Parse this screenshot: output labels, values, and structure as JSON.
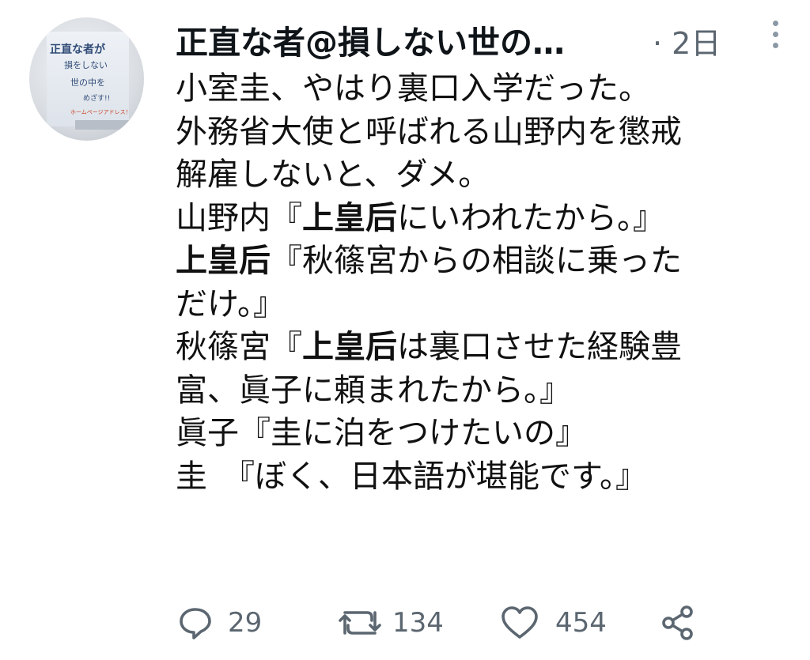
{
  "tweet": {
    "author_name": "正直な者@損しない世の…",
    "timestamp": "· 2日",
    "lines": [
      [
        {
          "t": "小室圭、やはり裏口入学だった。",
          "b": false
        }
      ],
      [
        {
          "t": "外務省大使と呼ばれる山野内を懲戒",
          "b": false
        }
      ],
      [
        {
          "t": "解雇しないと、ダメ。",
          "b": false
        }
      ],
      [
        {
          "t": "山野内『",
          "b": false
        },
        {
          "t": "上皇后",
          "b": true
        },
        {
          "t": "にいわれたから。』",
          "b": false
        }
      ],
      [
        {
          "t": "上皇后",
          "b": true
        },
        {
          "t": "『秋篠宮からの相談に乗った",
          "b": false
        }
      ],
      [
        {
          "t": "だけ。』",
          "b": false
        }
      ],
      [
        {
          "t": "秋篠宮『",
          "b": false
        },
        {
          "t": "上皇后",
          "b": true
        },
        {
          "t": "は裏口させた経験豊",
          "b": false
        }
      ],
      [
        {
          "t": "富、眞子に頼まれたから。』",
          "b": false
        }
      ],
      [
        {
          "t": "眞子『圭に泊をつけたいの』",
          "b": false
        }
      ],
      [
        {
          "t": "圭　『ぼく、日本語が堪能です。』",
          "b": false
        }
      ]
    ]
  },
  "avatar": {
    "line1": "正直な者が",
    "line2": "損をしない",
    "line3": "世の中を",
    "line4": "めざす!!",
    "line5": "ホームページアドレス！"
  },
  "actions": {
    "reply_count": "29",
    "retweet_count": "134",
    "like_count": "454"
  },
  "icons": {
    "reply": "reply-icon",
    "retweet": "retweet-icon",
    "like": "heart-icon",
    "share": "share-icon",
    "more": "more-vertical-icon"
  },
  "colors": {
    "text": "#111111",
    "muted": "#5b6670",
    "icon": "#5b6670"
  }
}
